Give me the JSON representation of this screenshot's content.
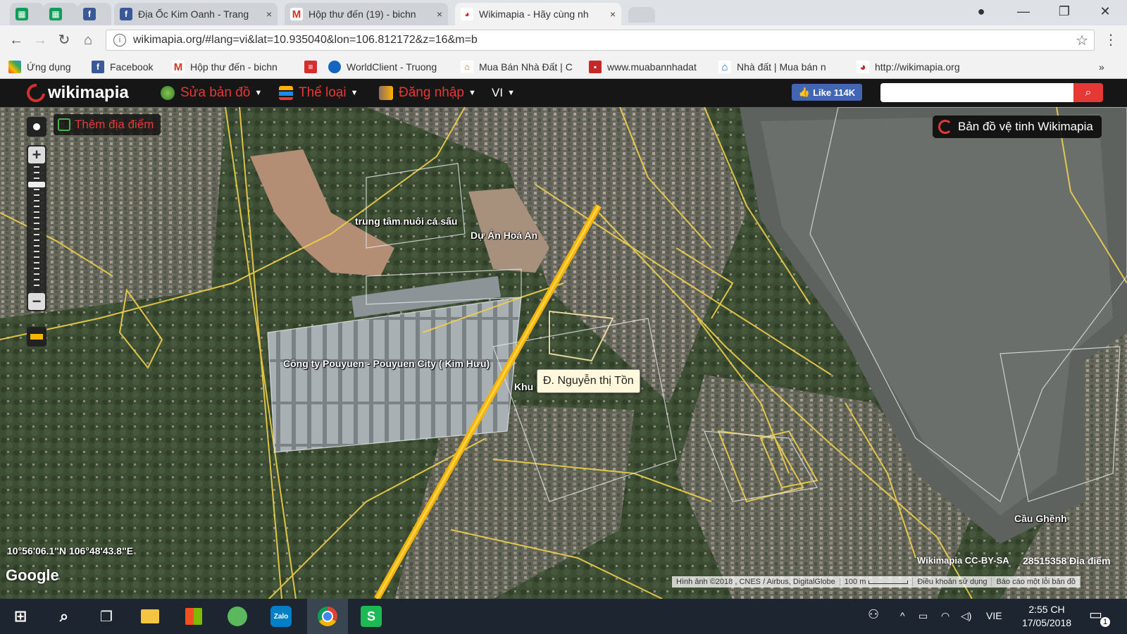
{
  "browser": {
    "tabs": [
      {
        "title": "",
        "icon": "sheets-icon"
      },
      {
        "title": "",
        "icon": "sheets-icon"
      },
      {
        "title": "",
        "icon": "facebook-icon"
      },
      {
        "title": "Địa Ốc Kim Oanh - Trang",
        "icon": "facebook-icon"
      },
      {
        "title": "Hộp thư đến (19) - bichn",
        "icon": "gmail-icon"
      },
      {
        "title": "Wikimapia - Hãy cùng nh",
        "icon": "wikimapia-icon",
        "active": true
      }
    ],
    "close_glyph": "×",
    "url": "wikimapia.org/#lang=vi&lat=10.935040&lon=106.812172&z=16&m=b",
    "bookmarks": [
      {
        "label": "Ứng dụng",
        "icon": "apps-grid-icon"
      },
      {
        "label": "Facebook",
        "icon": "facebook-icon"
      },
      {
        "label": "Hộp thư đến - bichn",
        "icon": "gmail-icon"
      },
      {
        "label": "",
        "icon": "bookmark-red-icon"
      },
      {
        "label": "WorldClient - Truong",
        "icon": "globe-icon"
      },
      {
        "label": "Mua Bán Nhà Đất | C",
        "icon": "house-icon"
      },
      {
        "label": "www.muabannhadat",
        "icon": "muaban-icon"
      },
      {
        "label": "Nhà đất | Mua bán n",
        "icon": "home-blue-icon"
      },
      {
        "label": "http://wikimapia.org",
        "icon": "wikimapia-icon"
      }
    ],
    "more_bookmarks": "»"
  },
  "wikimapia": {
    "logo_text": "wikimapia",
    "menu": [
      {
        "label": "Sửa bản đồ",
        "icon": "edit-map-icon"
      },
      {
        "label": "Thể loại",
        "icon": "categories-icon"
      },
      {
        "label": "Đăng nhập",
        "icon": "login-icon"
      }
    ],
    "language": "VI",
    "fb_like": "Like 114K",
    "search_placeholder": "",
    "add_place": "Thêm địa điểm",
    "satellite_button": "Bản đồ vệ tinh Wikimapia"
  },
  "map": {
    "labels": {
      "crocodile": "trung tâm nuôi cá sấu",
      "hoa_an": "Dự Án Hoá An",
      "pouyuen": "Công ty Pouyuen - Pouyuen City ( Kim Hưu)",
      "buu_hoa": "Khu dân cư Bửu Hoà",
      "cau_ghenh": "Cầu Ghềnh"
    },
    "tooltip": "Đ. Nguyễn thị Tồn",
    "coordinates": "10°56'06.1\"N 106°48'43.8\"E",
    "google": "Google",
    "license": "Wikimapia CC-BY-SA",
    "place_count": "28515358 Địa điểm",
    "imagery": "Hình ảnh ©2018 , CNES / Airbus, DigitalGlobe",
    "scale": "100 m",
    "terms": "Điều khoản sử dụng",
    "report": "Báo cáo một lỗi bản đồ",
    "zoom_level_fraction": 0.85
  },
  "taskbar": {
    "apps": [
      "windows-start-icon",
      "search-icon",
      "task-view-icon",
      "file-explorer-icon",
      "store-icon",
      "green-app-icon",
      "zalo-icon",
      "chrome-icon",
      "green-s-icon"
    ],
    "zalo_label": "Zalo",
    "language": "VIE",
    "time": "2:55 CH",
    "date": "17/05/2018",
    "notification_count": "1"
  }
}
